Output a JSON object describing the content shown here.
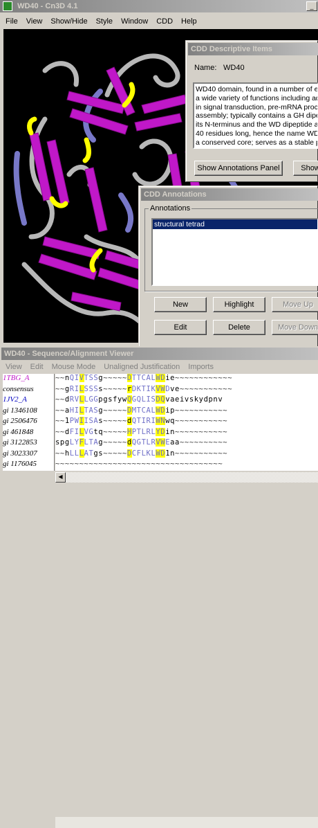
{
  "main": {
    "title": "WD40 - Cn3D 4.1",
    "menu": [
      "File",
      "View",
      "Show/Hide",
      "Style",
      "Window",
      "CDD",
      "Help"
    ]
  },
  "descriptive": {
    "title": "CDD Descriptive Items",
    "name_label": "Name:",
    "name_value": "WD40",
    "text_lines": [
      "WD40 domain, found in a number of e",
      "a wide variety of functions including ad",
      "in signal transduction, pre-mRNA proce",
      "assembly; typically contains a GH dipe",
      "its N-terminus and the WD dipeptide a",
      "40 residues long, hence the name WD",
      "a conserved core; serves as a stable p"
    ],
    "show_annotations_label": "Show Annotations Panel",
    "show_label": "Show"
  },
  "annotations": {
    "title": "CDD Annotations",
    "group_label": "Annotations",
    "items": [
      "structural tetrad"
    ],
    "new_label": "New",
    "highlight_label": "Highlight",
    "move_up_label": "Move Up",
    "edit_label": "Edit",
    "delete_label": "Delete",
    "move_down_label": "Move Down"
  },
  "viewer": {
    "title": "WD40 - Sequence/Alignment Viewer",
    "menu": [
      "View",
      "Edit",
      "Mouse Mode",
      "Unaligned Justification",
      "Imports"
    ],
    "rows": [
      {
        "label": "1TBG_A",
        "seq": "~~nQIVTSSg~~~~~DTTCALWDie~~~~~~~~~~~~"
      },
      {
        "label": "consensus",
        "seq": "~~gRILSSSs~~~~~rDKTIKVWDve~~~~~~~~~~~"
      },
      {
        "label": "1JV2_A",
        "seq": "~~dRVLLGGpgsfywQGQLISDQvaeivskydpnv"
      },
      {
        "label": "gi 1346108",
        "seq": "~~aHILTASg~~~~~DMTCALWDip~~~~~~~~~~~"
      },
      {
        "label": "gi 2506476",
        "seq": "~~1PWIISAs~~~~~dQTIRIWNwq~~~~~~~~~~~"
      },
      {
        "label": "gi 461848",
        "seq": "~~dFILVGtq~~~~~HPTLRLYDin~~~~~~~~~~~"
      },
      {
        "label": "gi 3122853",
        "seq": "spgLYFLTAg~~~~~dQGTLRVWEaa~~~~~~~~~~"
      },
      {
        "label": "gi 3023307",
        "seq": "~~hLLLATgs~~~~~DCFLKLWD1n~~~~~~~~~~~"
      },
      {
        "label": "gi 1176045",
        "seq": "~~~~~~~~~~~~~~~~~~~~~~~~~~~~~~~~~~~"
      }
    ]
  },
  "colors": {
    "active_title": "#0a246a",
    "inactive_title": "#808080",
    "strand": "#c018c8",
    "helix_yellow": "#ffff00",
    "aligned": "#7070c8",
    "highlight": "#ffff00",
    "selection": "#0a246a"
  },
  "icons": [
    "app-icon",
    "close-icon",
    "maximize-icon",
    "minimize-icon"
  ]
}
